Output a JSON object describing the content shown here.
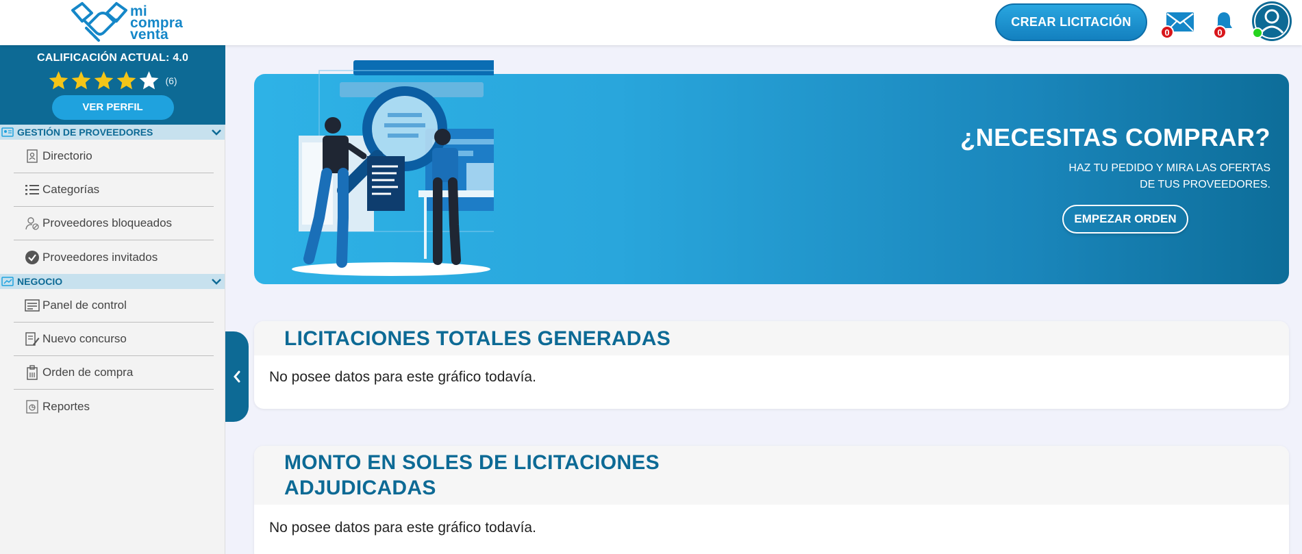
{
  "header": {
    "logo": {
      "line1": "mi",
      "line2": "compra",
      "line3": "venta"
    },
    "create_button": "CREAR LICITACIÓN",
    "messages_count": "0",
    "notifications_count": "0"
  },
  "sidebar": {
    "rating_title": "CALIFICACIÓN ACTUAL: 4.0",
    "rating_value": 4,
    "rating_count": "(6)",
    "profile_button": "VER PERFIL",
    "sections": [
      {
        "title": "GESTIÓN DE PROVEEDORES",
        "items": [
          {
            "label": "Directorio",
            "icon": "directory-icon"
          },
          {
            "label": "Categorías",
            "icon": "list-icon"
          },
          {
            "label": "Proveedores bloqueados",
            "icon": "blocked-user-icon"
          },
          {
            "label": "Proveedores invitados",
            "icon": "check-circle-icon"
          }
        ]
      },
      {
        "title": "NEGOCIO",
        "items": [
          {
            "label": "Panel de control",
            "icon": "control-panel-icon"
          },
          {
            "label": "Nuevo concurso",
            "icon": "edit-document-icon"
          },
          {
            "label": "Orden de compra",
            "icon": "clipboard-icon"
          },
          {
            "label": "Reportes",
            "icon": "report-icon"
          }
        ]
      }
    ]
  },
  "banner": {
    "title": "¿NECESITAS COMPRAR?",
    "subtitle_line1": "HAZ TU PEDIDO Y MIRA LAS OFERTAS",
    "subtitle_line2": "DE TUS PROVEEDORES.",
    "button": "EMPEZAR ORDEN"
  },
  "cards": [
    {
      "title_line1": "LICITACIONES TOTALES GENERADAS",
      "title_line2": "",
      "body": "No posee datos para este gráfico todavía."
    },
    {
      "title_line1": "MONTO EN SOLES DE LICITACIONES",
      "title_line2": "ADJUDICADAS",
      "body": "No posee datos para este gráfico todavía."
    }
  ],
  "colors": {
    "primary": "#0d6a95",
    "accent": "#1fa2de",
    "badge": "#d8161b",
    "online": "#26d31f"
  }
}
